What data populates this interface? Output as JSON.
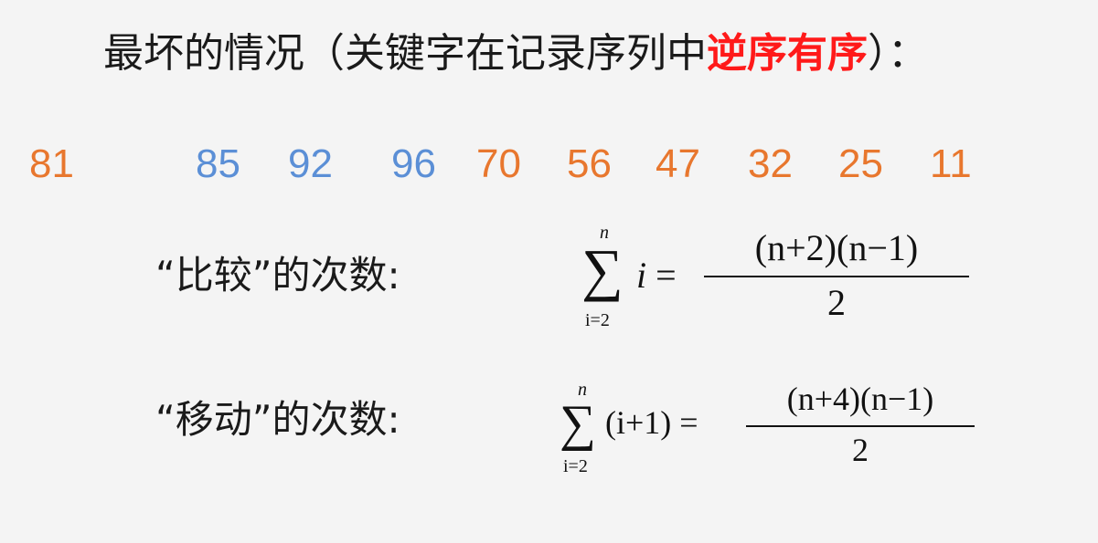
{
  "title": {
    "prefix": "最坏的情况（关键字在记录序列中",
    "highlight": "逆序有序",
    "suffix": "）："
  },
  "sequence": [
    {
      "value": "81",
      "color": "orange"
    },
    {
      "value": "85",
      "color": "blue"
    },
    {
      "value": "92",
      "color": "blue"
    },
    {
      "value": "96",
      "color": "blue"
    },
    {
      "value": "70",
      "color": "orange"
    },
    {
      "value": "56",
      "color": "orange"
    },
    {
      "value": "47",
      "color": "orange"
    },
    {
      "value": "32",
      "color": "orange"
    },
    {
      "value": "25",
      "color": "orange"
    },
    {
      "value": "11",
      "color": "orange"
    }
  ],
  "colors": {
    "orange": "#e8772e",
    "blue": "#5b8fd6",
    "highlight": "#ff1a1a"
  },
  "compare": {
    "label": "“比较”的次数:",
    "sum_upper": "n",
    "sum_lower": "i=2",
    "summand": "i",
    "numerator": "(n+2)(n−1)",
    "denominator": "2"
  },
  "move": {
    "label": "“移动”的次数:",
    "sum_upper": "n",
    "sum_lower": "i=2",
    "summand": "(i+1)",
    "numerator": "(n+4)(n−1)",
    "denominator": "2"
  }
}
